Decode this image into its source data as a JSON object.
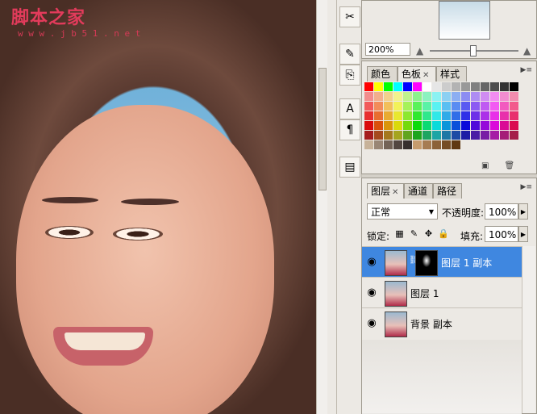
{
  "watermark": {
    "title": "脚本之家",
    "url": "w w w . j b 5 1 . n e t"
  },
  "navigator": {
    "zoom": "200%",
    "zoom_out_icon": "mountain-small-icon",
    "zoom_in_icon": "mountain-large-icon"
  },
  "swatches_panel": {
    "tabs": [
      {
        "label": "颜色",
        "active": false
      },
      {
        "label": "色板",
        "active": true
      },
      {
        "label": "样式",
        "active": false
      }
    ]
  },
  "layers_panel": {
    "tabs": [
      {
        "label": "图层",
        "active": true
      },
      {
        "label": "通道",
        "active": false
      },
      {
        "label": "路径",
        "active": false
      }
    ],
    "blend_mode": "正常",
    "opacity_label": "不透明度:",
    "opacity_value": "100%",
    "lock_label": "锁定:",
    "fill_label": "填充:",
    "fill_value": "100%",
    "layers": [
      {
        "name": "图层 1 副本",
        "selected": true,
        "has_mask": true
      },
      {
        "name": "图层 1",
        "selected": false,
        "has_mask": false
      },
      {
        "name": "背景 副本",
        "selected": false,
        "has_mask": false
      }
    ]
  },
  "colors": {
    "selection": "#3f87e0",
    "panel_bg": "#ece9e4"
  }
}
